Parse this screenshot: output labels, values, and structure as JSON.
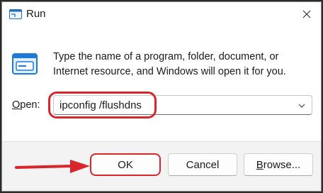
{
  "window": {
    "title": "Run",
    "close_icon": "close-icon",
    "accent_color": "#d9262b"
  },
  "dialog": {
    "description": "Type the name of a program, folder, document, or Internet resource, and Windows will open it for you.",
    "open_label_underlined": "O",
    "open_label_rest": "pen:",
    "command_value": "ipconfig /flushdns"
  },
  "buttons": {
    "ok": "OK",
    "cancel": "Cancel",
    "browse_underlined": "B",
    "browse_rest": "rowse..."
  }
}
